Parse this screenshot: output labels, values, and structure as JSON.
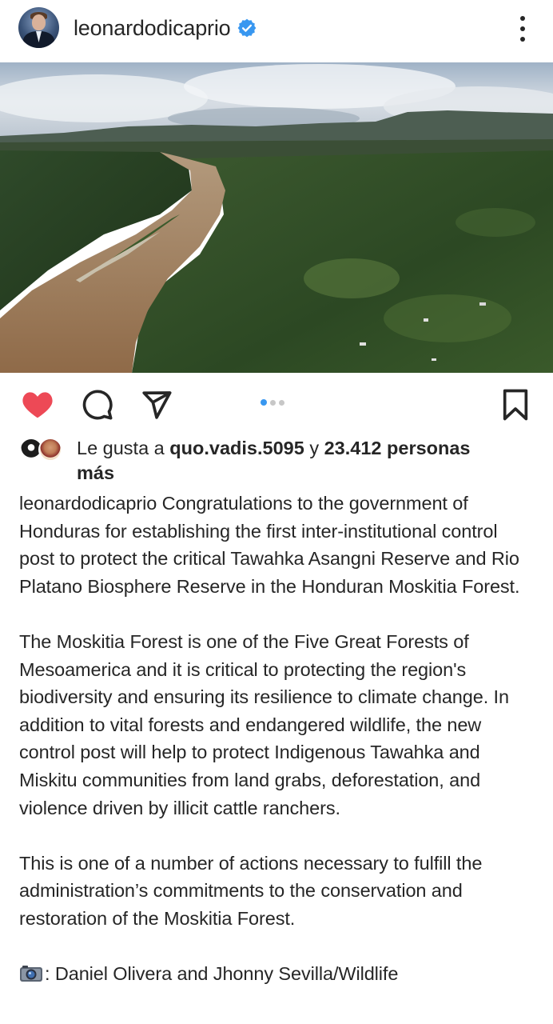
{
  "post": {
    "username": "leonardodicaprio",
    "verified": true,
    "image_alt": "aerial river forest",
    "carousel": {
      "count": 3,
      "active": 1
    }
  },
  "actions": {
    "liked": true,
    "like_icon": "heart-icon",
    "comment_icon": "comment-icon",
    "share_icon": "send-icon",
    "save_icon": "bookmark-icon"
  },
  "likes": {
    "prefix": "Le gusta a ",
    "user": "quo.vadis.5095",
    "middle": " y ",
    "count_text": "23.412 personas",
    "suffix": "más"
  },
  "caption": {
    "username": "leonardodicaprio",
    "para1": " Congratulations to the government of Honduras for establishing the first inter-institutional control post to protect the critical Tawahka Asangni Reserve and Rio Platano Biosphere Reserve in the Honduran Moskitia Forest.",
    "para2": "The Moskitia Forest is one of the Five Great Forests of Mesoamerica and it is critical to protecting the region's biodiversity and ensuring its resilience to climate change. In addition to vital forests and endangered wildlife, the new control post will help to protect Indigenous Tawahka and Miskitu communities from land grabs, deforestation, and violence driven by illicit cattle ranchers.",
    "para3": "This is one of a number of actions necessary to fulfill the administration’s commitments to the conservation and restoration of the Moskitia Forest.",
    "credit_icon": "camera-icon",
    "credit": ": Daniel Olivera and Jhonny Sevilla/Wildlife"
  },
  "colors": {
    "text": "#262626",
    "like_red": "#ed4956",
    "verified_blue": "#3897f0",
    "dot_active": "#3897f0",
    "dot_inactive": "#c7c7c7"
  }
}
